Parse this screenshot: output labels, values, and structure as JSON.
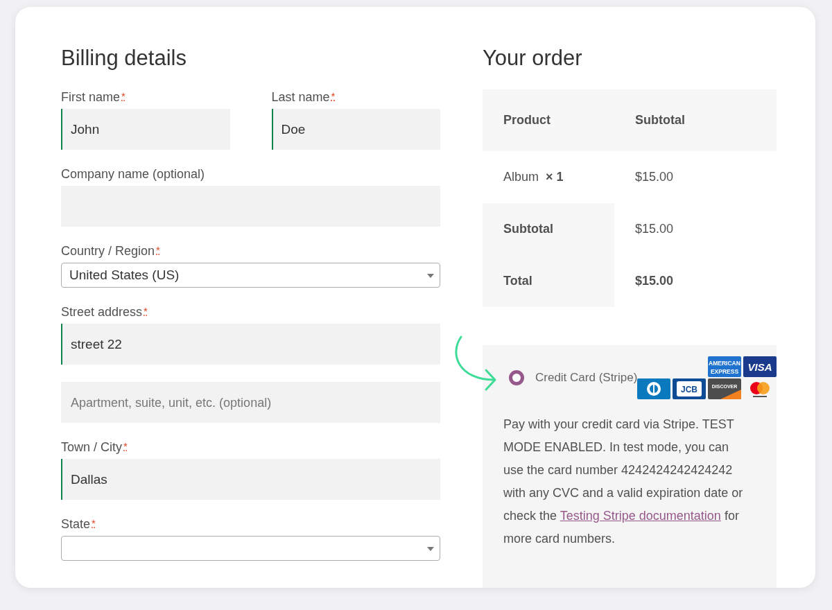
{
  "billing": {
    "title": "Billing details",
    "rows": [
      [
        {
          "kind": "text",
          "label": "First name",
          "required_mark": "*",
          "value": "John",
          "valid": true
        },
        {
          "kind": "text",
          "label": "Last name",
          "required_mark": "*",
          "value": "Doe",
          "valid": true
        }
      ],
      [
        {
          "kind": "text",
          "label": "Company name (optional)",
          "valid": false
        }
      ],
      [
        {
          "kind": "select",
          "label": "Country / Region",
          "required_mark": "*",
          "value": "United States (US)"
        }
      ],
      [
        {
          "kind": "text",
          "label": "Street address",
          "required_mark": "*",
          "value": "street 22",
          "valid": true
        }
      ],
      [
        {
          "kind": "text",
          "placeholder": "Apartment, suite, unit, etc. (optional)",
          "valid": false
        }
      ],
      [
        {
          "kind": "text",
          "label": "Town / City",
          "required_mark": "*",
          "value": "Dallas",
          "valid": true
        }
      ],
      [
        {
          "kind": "select",
          "label": "State",
          "required_mark": "*"
        }
      ]
    ]
  },
  "order": {
    "title": "Your order",
    "columns": [
      "Product",
      "Subtotal"
    ],
    "items": [
      {
        "name": "Album",
        "qty": "× 1",
        "subtotal": "$15.00"
      }
    ],
    "totals": [
      {
        "label": "Subtotal",
        "value": "$15.00",
        "strong": false
      },
      {
        "label": "Total",
        "value": "$15.00",
        "strong": true
      }
    ],
    "payment": {
      "method": "Credit Card (Stripe)",
      "selected": true,
      "cards": [
        {
          "kind": "amex",
          "label": "AMERICAN EXPRESS"
        },
        {
          "kind": "visa",
          "label": "VISA"
        },
        {
          "kind": "diners"
        },
        {
          "kind": "jcb",
          "label": "JCB"
        },
        {
          "kind": "discover",
          "label": "DISCOVER"
        },
        {
          "kind": "mastercard"
        }
      ],
      "description": "Pay with your credit card via Stripe. TEST MODE ENABLED. In test mode, you can use the card number 4242424242424242 with any CVC and a valid expiration date or check the",
      "link": "Testing Stripe documentation",
      "after": "for more card numbers."
    }
  }
}
